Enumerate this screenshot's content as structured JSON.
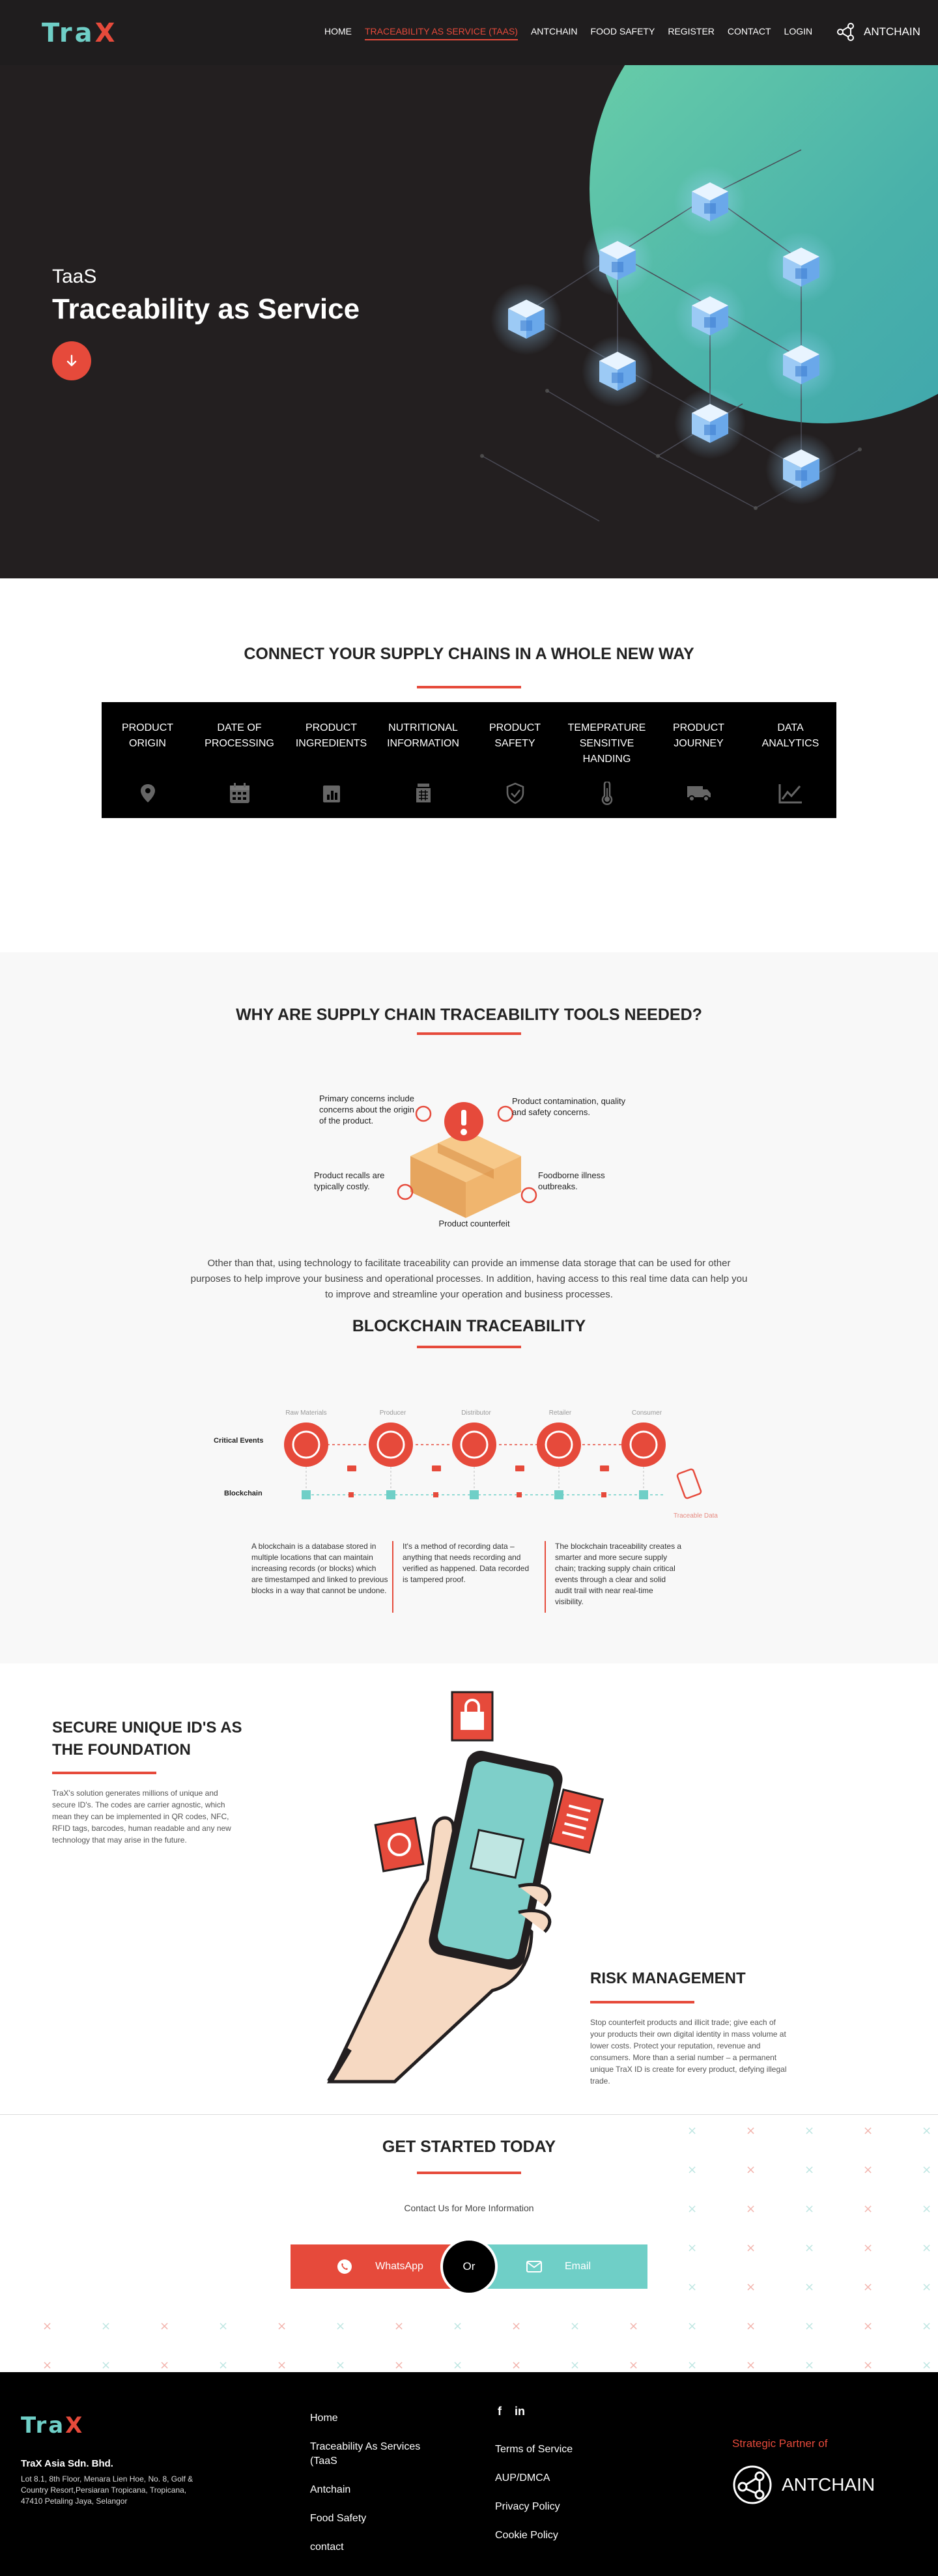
{
  "nav": {
    "logo": "TraX",
    "links": [
      "HOME",
      "TRACEABILITY AS SERVICE (TAAS)",
      "ANTCHAIN",
      "FOOD SAFETY",
      "REGISTER",
      "CONTACT",
      "LOGIN"
    ],
    "active_index": 1,
    "partner_brand": "ANTCHAIN"
  },
  "hero": {
    "subtitle": "TaaS",
    "title": "Traceability as Service",
    "scroll_icon": "arrow-down-icon"
  },
  "connect": {
    "title": "CONNECT YOUR SUPPLY CHAINS IN A WHOLE NEW WAY",
    "features": [
      {
        "label": "PRODUCT ORIGIN",
        "icon": "location-pin-icon"
      },
      {
        "label": "DATE OF PROCESSING",
        "icon": "calendar-icon"
      },
      {
        "label": "PRODUCT INGREDIENTS",
        "icon": "ingredients-chart-icon"
      },
      {
        "label": "NUTRITIONAL INFORMATION",
        "icon": "nutrition-jar-icon"
      },
      {
        "label": "PRODUCT SAFETY",
        "icon": "shield-check-icon"
      },
      {
        "label": "TEMEPRATURE SENSITIVE HANDING",
        "icon": "thermometer-icon"
      },
      {
        "label": "PRODUCT JOURNEY",
        "icon": "truck-icon"
      },
      {
        "label": "DATA ANALYTICS",
        "icon": "line-chart-icon"
      }
    ]
  },
  "why": {
    "title": "WHY ARE SUPPLY CHAIN TRACEABILITY TOOLS NEEDED?",
    "concerns": {
      "origin": "Primary concerns include concerns about the origin of the product.",
      "contamination": "Product contamination, quality and safety concerns.",
      "recalls": "Product recalls are typically costly.",
      "foodborne": "Foodborne illness outbreaks.",
      "counterfeit": "Product counterfeit"
    },
    "paragraph": "Other than that, using technology to facilitate traceability can provide an immense data storage that can be used for other purposes to help improve your business and operational processes. In addition, having access to this real time data can help you to improve and streamline your operation and business processes."
  },
  "blockchain": {
    "title": "BLOCKCHAIN TRACEABILITY",
    "row_labels": {
      "events": "Critical Events",
      "chain": "Blockchain"
    },
    "stages": [
      "Raw Materials",
      "Producer",
      "Distributor",
      "Retailer",
      "Consumer"
    ],
    "end_label": "Traceable Data",
    "columns": [
      "A blockchain is a database stored in multiple locations that can maintain increasing records (or blocks) which are timestamped and linked to previous blocks in a way that cannot be undone.",
      "It's a method of recording data – anything that needs recording and verified as happened. Data recorded is tampered proof.",
      "The blockchain traceability creates a smarter and more secure supply chain; tracking supply chain critical events through a clear and solid audit trail with near real-time visibility."
    ]
  },
  "secure": {
    "title": "SECURE UNIQUE ID'S AS THE FOUNDATION",
    "text": "TraX's solution generates millions of unique and secure ID's. The codes are carrier agnostic, which mean they can be implemented in QR codes, NFC, RFID tags, barcodes, human readable and any new technology that may arise in the future.",
    "risk_title": "RISK MANAGEMENT",
    "risk_text": "Stop counterfeit products and illicit trade; give each of your products their own digital identity in mass volume at lower costs. Protect your reputation, revenue and consumers. More than a serial number – a permanent unique TraX ID is create for every product, defying illegal trade."
  },
  "get_started": {
    "title": "GET STARTED TODAY",
    "contact_text": "Contact Us for More Information",
    "whatsapp_label": "WhatsApp",
    "or_label": "Or",
    "email_label": "Email"
  },
  "footer": {
    "logo": "TraX",
    "company": "TraX Asia Sdn. Bhd.",
    "address": "Lot 8.1, 8th Floor, Menara Lien Hoe, No. 8, Golf & Country Resort,Persiaran Tropicana, Tropicana, 47410 Petaling Jaya, Selangor",
    "col1": [
      "Home",
      "Traceability As Services (TaaS",
      "Antchain",
      "Food Safety",
      "contact"
    ],
    "col2": [
      "Terms of Service",
      "AUP/DMCA",
      "Privacy Policy",
      "Cookie Policy"
    ],
    "social": [
      "f",
      "in"
    ],
    "partner_label": "Strategic Partner of",
    "partner_name": "ANTCHAIN"
  },
  "colors": {
    "accent_red": "#e64a3b",
    "accent_teal": "#6fcfc7",
    "dark_bg": "#231f20"
  }
}
